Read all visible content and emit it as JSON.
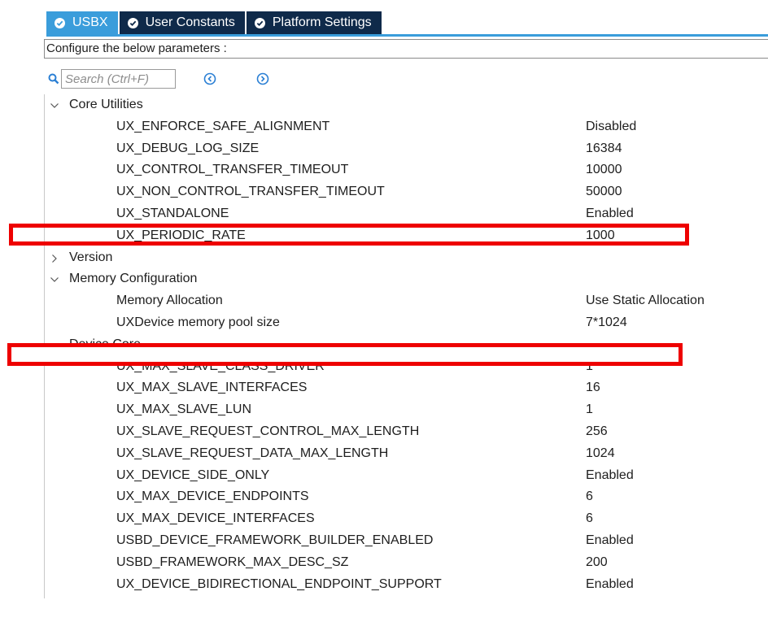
{
  "tabs": [
    {
      "label": "USBX",
      "active": true
    },
    {
      "label": "User Constants",
      "active": false
    },
    {
      "label": "Platform Settings",
      "active": false
    }
  ],
  "description": "Configure the below parameters :",
  "search": {
    "placeholder": "Search (Ctrl+F)",
    "value": ""
  },
  "groups": [
    {
      "label": "Core Utilities",
      "expanded": true,
      "params": [
        {
          "name": "UX_ENFORCE_SAFE_ALIGNMENT",
          "value": "Disabled"
        },
        {
          "name": "UX_DEBUG_LOG_SIZE",
          "value": "16384"
        },
        {
          "name": "UX_CONTROL_TRANSFER_TIMEOUT",
          "value": "10000"
        },
        {
          "name": "UX_NON_CONTROL_TRANSFER_TIMEOUT",
          "value": "50000"
        },
        {
          "name": "UX_STANDALONE",
          "value": "Enabled"
        },
        {
          "name": "UX_PERIODIC_RATE",
          "value": "1000"
        }
      ]
    },
    {
      "label": "Version",
      "expanded": false,
      "params": []
    },
    {
      "label": "Memory Configuration",
      "expanded": true,
      "params": [
        {
          "name": "Memory Allocation",
          "value": "Use Static Allocation"
        },
        {
          "name": "UXDevice memory pool size",
          "value": "7*1024"
        }
      ]
    },
    {
      "label": "Device Core",
      "expanded": true,
      "params": [
        {
          "name": "UX_MAX_SLAVE_CLASS_DRIVER",
          "value": "1"
        },
        {
          "name": "UX_MAX_SLAVE_INTERFACES",
          "value": "16"
        },
        {
          "name": "UX_MAX_SLAVE_LUN",
          "value": "1"
        },
        {
          "name": "UX_SLAVE_REQUEST_CONTROL_MAX_LENGTH",
          "value": "256"
        },
        {
          "name": "UX_SLAVE_REQUEST_DATA_MAX_LENGTH",
          "value": "1024"
        },
        {
          "name": "UX_DEVICE_SIDE_ONLY",
          "value": "Enabled"
        },
        {
          "name": "UX_MAX_DEVICE_ENDPOINTS",
          "value": "6"
        },
        {
          "name": "UX_MAX_DEVICE_INTERFACES",
          "value": "6"
        },
        {
          "name": "USBD_DEVICE_FRAMEWORK_BUILDER_ENABLED",
          "value": "Enabled"
        },
        {
          "name": "USBD_FRAMEWORK_MAX_DESC_SZ",
          "value": "200"
        },
        {
          "name": "UX_DEVICE_BIDIRECTIONAL_ENDPOINT_SUPPORT",
          "value": "Enabled"
        }
      ]
    }
  ],
  "colors": {
    "tab_active": "#3a9ddb",
    "tab_inactive": "#0f2a4a",
    "highlight": "#ee0000",
    "accent_icon": "#2a7fd4"
  }
}
